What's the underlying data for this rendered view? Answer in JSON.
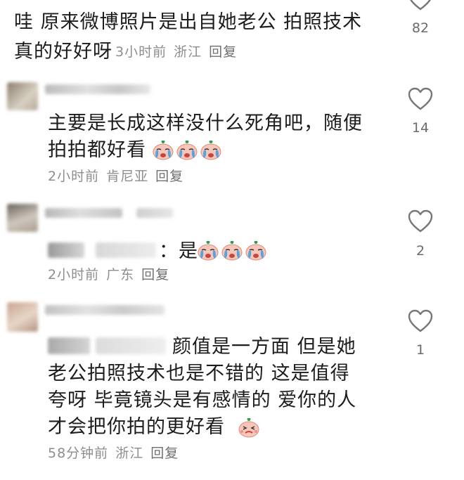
{
  "comments": [
    {
      "line1": "哇 原来微博照片是出自她老公 拍照技术",
      "line2": "真的好好呀",
      "time": "3小时前",
      "location": "浙江",
      "reply": "回复",
      "likes": "82"
    },
    {
      "line1": "主要是长成这样没什么死角吧，随便",
      "line2": "拍拍都好看",
      "time": "2小时前",
      "location": "肯尼亚",
      "reply": "回复",
      "likes": "14"
    },
    {
      "text": "是",
      "prefix_colon": "：",
      "time": "2小时前",
      "location": "广东",
      "reply": "回复",
      "likes": "2"
    },
    {
      "line1": "颜值是一方面 但是她",
      "line2": "老公拍照技术也是不错的 这是值得",
      "line3": "夸呀 毕竟镜头是有感情的 爱你的人",
      "line4": "才会把你拍的更好看",
      "time": "58分钟前",
      "location": "浙江",
      "reply": "回复",
      "likes": "1"
    }
  ],
  "icons": {
    "like": "heart-outline-icon",
    "cry_emoji": "crying-face-emoji-icon",
    "tearful_emoji": "tearful-face-emoji-icon"
  },
  "colors": {
    "text": "#1c1c1c",
    "meta": "#8d8d8d",
    "icon": "#777777"
  }
}
